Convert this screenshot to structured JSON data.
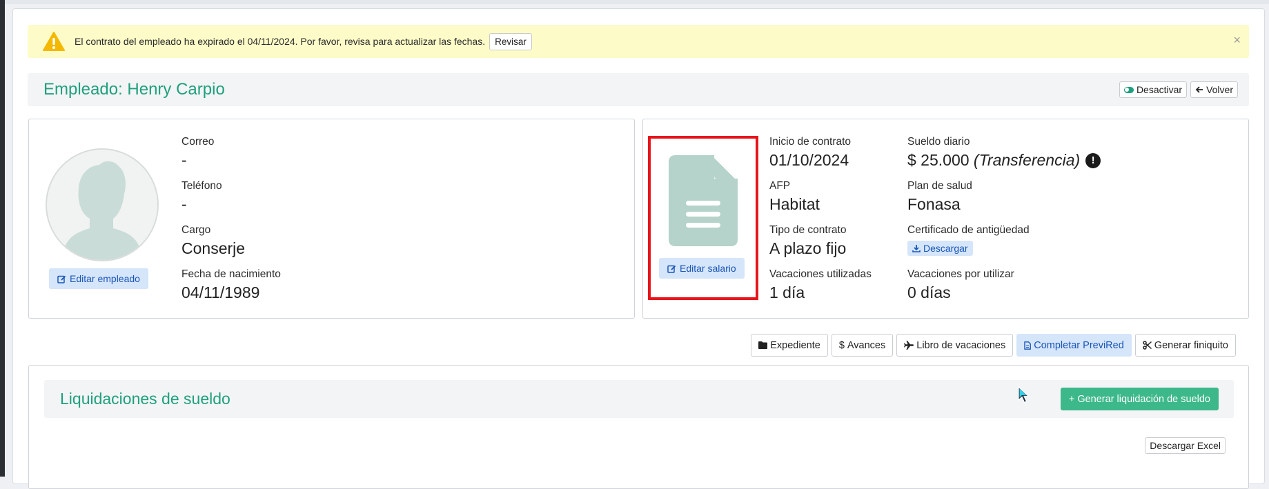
{
  "alert": {
    "message": "El contrato del empleado ha expirado el 04/11/2024. Por favor, revisa para actualizar las fechas.",
    "review_label": "Revisar",
    "close_symbol": "×",
    "icon": "warning-triangle-icon",
    "icon_color": "#f5b800"
  },
  "header": {
    "title": "Empleado: Henry Carpio",
    "deactivate_label": "Desactivar",
    "back_label": "Volver"
  },
  "employee": {
    "edit_label": "Editar empleado",
    "fields": [
      {
        "label": "Correo",
        "value": "-"
      },
      {
        "label": "Teléfono",
        "value": "-"
      },
      {
        "label": "Cargo",
        "value": "Conserje"
      },
      {
        "label": "Fecha de nacimiento",
        "value": "04/11/1989"
      }
    ]
  },
  "contract": {
    "edit_salary_label": "Editar salario",
    "start": {
      "label": "Inicio de contrato",
      "value": "01/10/2024"
    },
    "salary": {
      "label": "Sueldo diario",
      "value": "$ 25.000",
      "note": "(Transferencia)",
      "info_symbol": "!"
    },
    "afp": {
      "label": "AFP",
      "value": "Habitat"
    },
    "health": {
      "label": "Plan de salud",
      "value": "Fonasa"
    },
    "type": {
      "label": "Tipo de contrato",
      "value": "A plazo fijo"
    },
    "certificate": {
      "label": "Certificado de antigüedad",
      "download_label": "Descargar"
    },
    "vac_used": {
      "label": "Vacaciones utilizadas",
      "value": "1 día"
    },
    "vac_pending": {
      "label": "Vacaciones por utilizar",
      "value": "0 días"
    }
  },
  "actions": {
    "file": "Expediente",
    "advances": "Avances",
    "vacation_book": "Libro de vacaciones",
    "previred": "Completar PreviRed",
    "settlement": "Generar finiquito"
  },
  "payroll": {
    "title": "Liquidaciones de sueldo",
    "generate_label": "+ Generar liquidación de sueldo",
    "excel_label": "Descargar Excel"
  },
  "colors": {
    "accent": "#1fa07e",
    "alert_bg": "#fdfbc8",
    "highlight_border": "#e8141b",
    "link_blue": "#1a56b8",
    "button_green": "#3cb88a"
  }
}
